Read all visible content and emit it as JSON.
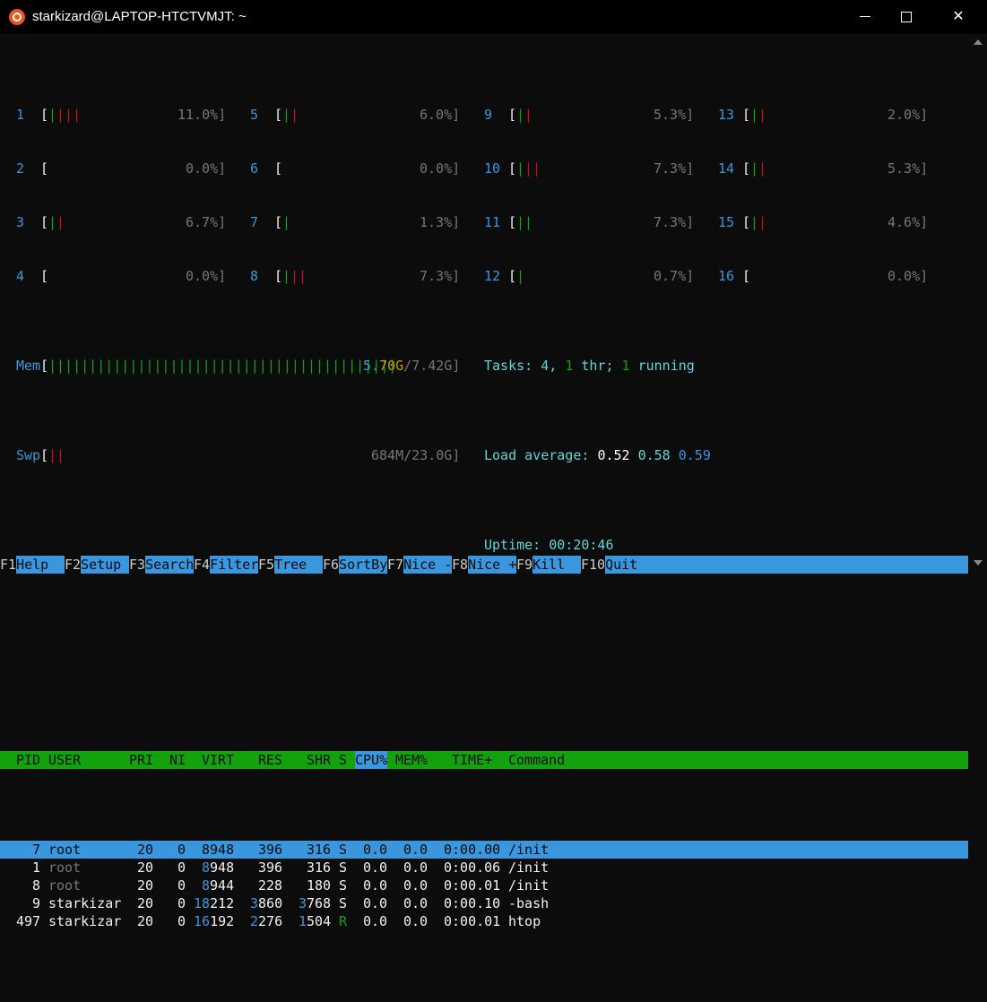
{
  "window": {
    "title": "starkizard@LAPTOP-HTCTVMJT: ~",
    "minimize_icon": "minimize-icon",
    "maximize_icon": "maximize-icon",
    "close_glyph": "✕"
  },
  "cpus": [
    {
      "id": "1",
      "bars": [
        [
          "g",
          "|"
        ],
        [
          "r",
          "|||"
        ]
      ],
      "pct": "11.0%]"
    },
    {
      "id": "2",
      "bars": [],
      "pct": "0.0%]"
    },
    {
      "id": "3",
      "bars": [
        [
          "g",
          "|"
        ],
        [
          "r",
          "|"
        ]
      ],
      "pct": "6.7%]"
    },
    {
      "id": "4",
      "bars": [],
      "pct": "0.0%]"
    },
    {
      "id": "5",
      "bars": [
        [
          "g",
          "|"
        ],
        [
          "r",
          "|"
        ]
      ],
      "pct": "6.0%]"
    },
    {
      "id": "6",
      "bars": [],
      "pct": "0.0%]"
    },
    {
      "id": "7",
      "bars": [
        [
          "g",
          "|"
        ]
      ],
      "pct": "1.3%]"
    },
    {
      "id": "8",
      "bars": [
        [
          "g",
          "|"
        ],
        [
          "r",
          "||"
        ]
      ],
      "pct": "7.3%]"
    },
    {
      "id": "9",
      "bars": [
        [
          "g",
          "|"
        ],
        [
          "r",
          "|"
        ]
      ],
      "pct": "5.3%]"
    },
    {
      "id": "10",
      "bars": [
        [
          "g",
          "|"
        ],
        [
          "r",
          "||"
        ]
      ],
      "pct": "7.3%]"
    },
    {
      "id": "11",
      "bars": [
        [
          "g",
          "||"
        ]
      ],
      "pct": "7.3%]"
    },
    {
      "id": "12",
      "bars": [
        [
          "g",
          "|"
        ]
      ],
      "pct": "0.7%]"
    },
    {
      "id": "13",
      "bars": [
        [
          "g",
          "|"
        ],
        [
          "r",
          "|"
        ]
      ],
      "pct": "2.0%]"
    },
    {
      "id": "14",
      "bars": [
        [
          "g",
          "|"
        ],
        [
          "r",
          "|"
        ]
      ],
      "pct": "5.3%]"
    },
    {
      "id": "15",
      "bars": [
        [
          "g",
          "|"
        ],
        [
          "r",
          "|"
        ]
      ],
      "pct": "4.6%]"
    },
    {
      "id": "16",
      "bars": [],
      "pct": "0.0%]"
    }
  ],
  "mem": {
    "label": "Mem",
    "bar": "|||||||||||||||||||||||||||||||||||||||||||",
    "value_a": "5.",
    "value_b": "70G",
    "value_c": "/7.42G]"
  },
  "swp": {
    "label": "Swp",
    "bar": "||",
    "value": "684M/23.0G]"
  },
  "tasks": {
    "label": "Tasks: ",
    "count": "4",
    "sep1": ", ",
    "thr": "1",
    "thr_label": " thr; ",
    "running": "1",
    "running_label": " running"
  },
  "load": {
    "label": "Load average: ",
    "l1": "0.52",
    "l5": "0.58",
    "l15": "0.59"
  },
  "uptime": {
    "label": "Uptime: ",
    "value": "00:20:46"
  },
  "columns": {
    "pid": "PID",
    "user": "USER",
    "pri": "PRI",
    "ni": "NI",
    "virt": "VIRT",
    "res": "RES",
    "shr": "SHR",
    "s": "S",
    "cpu": "CPU%",
    "mem": "MEM%",
    "time": "TIME+",
    "command": "Command"
  },
  "processes": [
    {
      "pid": "7",
      "user": "root",
      "pri": "20",
      "ni": "0",
      "virt_hi": "",
      "virt": "8948",
      "res_hi": "",
      "res": "396",
      "shr_hi": "",
      "shr": "316",
      "s": "S",
      "cpu": "0.0",
      "mem": "0.0",
      "time": "0:00.00",
      "cmd": "/init"
    },
    {
      "pid": "1",
      "user": "root",
      "pri": "20",
      "ni": "0",
      "virt_hi": "8",
      "virt": "948",
      "res_hi": "",
      "res": "396",
      "shr_hi": "",
      "shr": "316",
      "s": "S",
      "cpu": "0.0",
      "mem": "0.0",
      "time": "0:00.06",
      "cmd": "/init"
    },
    {
      "pid": "8",
      "user": "root",
      "pri": "20",
      "ni": "0",
      "virt_hi": "8",
      "virt": "944",
      "res_hi": "",
      "res": "228",
      "shr_hi": "",
      "shr": "180",
      "s": "S",
      "cpu": "0.0",
      "mem": "0.0",
      "time": "0:00.01",
      "cmd": "/init"
    },
    {
      "pid": "9",
      "user": "starkizar",
      "pri": "20",
      "ni": "0",
      "virt_hi": "18",
      "virt": "212",
      "res_hi": "3",
      "res": "860",
      "shr_hi": "3",
      "shr": "768",
      "s": "S",
      "cpu": "0.0",
      "mem": "0.0",
      "time": "0:00.10",
      "cmd": "-bash"
    },
    {
      "pid": "497",
      "user": "starkizar",
      "pri": "20",
      "ni": "0",
      "virt_hi": "16",
      "virt": "192",
      "res_hi": "2",
      "res": "276",
      "shr_hi": "1",
      "shr": "504",
      "s": "R",
      "cpu": "0.0",
      "mem": "0.0",
      "time": "0:00.01",
      "cmd": "htop"
    }
  ],
  "fkeys": [
    {
      "key": "F1",
      "label": "Help  "
    },
    {
      "key": "F2",
      "label": "Setup "
    },
    {
      "key": "F3",
      "label": "Search"
    },
    {
      "key": "F4",
      "label": "Filter"
    },
    {
      "key": "F5",
      "label": "Tree  "
    },
    {
      "key": "F6",
      "label": "SortBy"
    },
    {
      "key": "F7",
      "label": "Nice -"
    },
    {
      "key": "F8",
      "label": "Nice +"
    },
    {
      "key": "F9",
      "label": "Kill  "
    },
    {
      "key": "F10",
      "label": "Quit"
    }
  ],
  "colors": {
    "header_green": "#13a10e",
    "selection_blue": "#3a96dd",
    "bar_green": "#13a10e",
    "bar_red": "#c50f1f"
  }
}
